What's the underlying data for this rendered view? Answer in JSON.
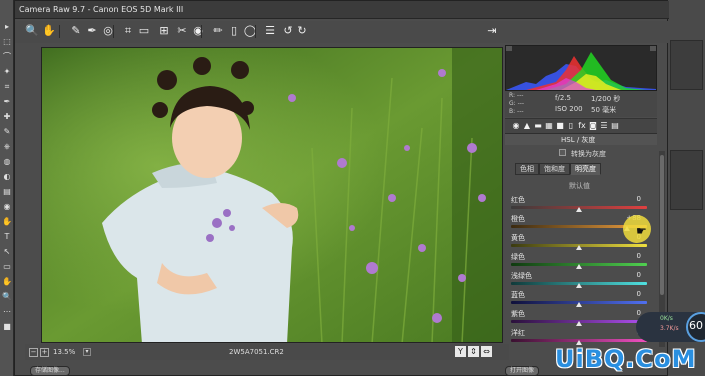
{
  "app": {
    "window_title": "Camera Raw 9.7 - Canon EOS 5D Mark III"
  },
  "toolbar": {
    "tools": [
      {
        "icon": "zoom-icon",
        "glyph": "🔍"
      },
      {
        "icon": "hand-icon",
        "glyph": "✋"
      },
      {
        "icon": "white-balance-icon",
        "glyph": "✎"
      },
      {
        "icon": "color-sampler-icon",
        "glyph": "✒"
      },
      {
        "icon": "target-adjust-icon",
        "glyph": "◎"
      },
      {
        "icon": "crop-icon",
        "glyph": "⌗"
      },
      {
        "icon": "straighten-icon",
        "glyph": "▭"
      },
      {
        "icon": "transform-icon",
        "glyph": "⊞"
      },
      {
        "icon": "spot-removal-icon",
        "glyph": "✂"
      },
      {
        "icon": "red-eye-icon",
        "glyph": "◉"
      },
      {
        "icon": "adjustment-brush-icon",
        "glyph": "✏"
      },
      {
        "icon": "graduated-filter-icon",
        "glyph": "▯"
      },
      {
        "icon": "radial-filter-icon",
        "glyph": "◯"
      },
      {
        "icon": "preferences-icon",
        "glyph": "☰"
      },
      {
        "icon": "rotate-ccw-icon",
        "glyph": "↺"
      },
      {
        "icon": "rotate-cw-icon",
        "glyph": "↻"
      }
    ],
    "open_image_glyph": "⇥"
  },
  "readout": {
    "r": "R: ---",
    "g": "G: ---",
    "b": "B: ---",
    "aperture": "f/2.5",
    "shutter": "1/200 秒",
    "iso": "ISO 200",
    "focal": "50 毫米"
  },
  "panel": {
    "icons": [
      "◉",
      "▲",
      "▬",
      "▦",
      "■",
      "▯",
      "fx",
      "◙",
      "☰",
      "▤"
    ],
    "header": "HSL / 灰度",
    "convert_gray": "转换为灰度",
    "tabs": [
      "色相",
      "饱和度",
      "明亮度"
    ],
    "active_tab": 2,
    "default_link": "默认值",
    "sliders": [
      {
        "label": "红色",
        "value": "0",
        "pos": 0.5,
        "colors": [
          "#3a3a3a",
          "#e04040"
        ]
      },
      {
        "label": "橙色",
        "value": "+88",
        "pos": 0.85,
        "colors": [
          "#3a2a10",
          "#f0a040"
        ]
      },
      {
        "label": "黄色",
        "value": "0",
        "pos": 0.5,
        "colors": [
          "#3a3a10",
          "#f0e040"
        ]
      },
      {
        "label": "绿色",
        "value": "0",
        "pos": 0.5,
        "colors": [
          "#103a10",
          "#50d050"
        ]
      },
      {
        "label": "浅绿色",
        "value": "0",
        "pos": 0.5,
        "colors": [
          "#103a3a",
          "#50e0e0"
        ]
      },
      {
        "label": "蓝色",
        "value": "0",
        "pos": 0.5,
        "colors": [
          "#10103a",
          "#5070f0"
        ]
      },
      {
        "label": "紫色",
        "value": "0",
        "pos": 0.5,
        "colors": [
          "#2a103a",
          "#b050f0"
        ]
      },
      {
        "label": "洋红",
        "value": "0",
        "pos": 0.5,
        "colors": [
          "#3a1030",
          "#f050c0"
        ]
      }
    ]
  },
  "bottom": {
    "zoom_out": "−",
    "zoom_in": "+",
    "zoom_level": "13.5%",
    "zoom_dropdown": "▾",
    "filename": "2W5A7051.CR2",
    "view_buttons": [
      "Y",
      "⇕",
      "⇔"
    ]
  },
  "partial_buttons": [
    "存储图像...",
    "打开图像"
  ],
  "network": {
    "percent": "60",
    "up": "0K/s",
    "down": "3.7K/s"
  },
  "watermark": "UiBQ.CoM",
  "ps_left_tools": [
    "▸",
    "⬚",
    "⌒",
    "✦",
    "⌗",
    "✒",
    "✚",
    "✎",
    "⎈",
    "◍",
    "◐",
    "▤",
    "◉",
    "✋",
    "T",
    "↖",
    "▭",
    "✋",
    "🔍",
    "⋯",
    "■"
  ]
}
